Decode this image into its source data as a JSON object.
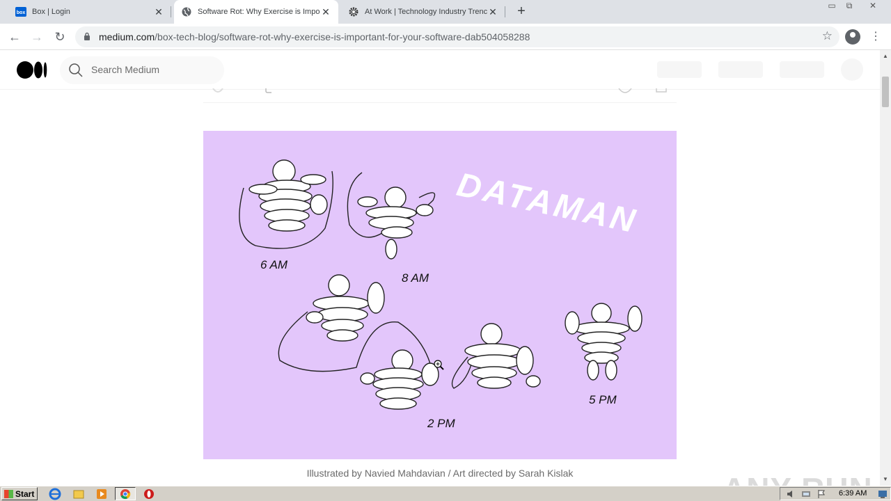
{
  "browser": {
    "tabs": [
      {
        "title": "Box | Login",
        "favicon": "box-favicon",
        "active": false
      },
      {
        "title": "Software Rot: Why Exercise is Impor",
        "favicon": "globe-icon",
        "active": true
      },
      {
        "title": "At Work | Technology Industry Trenc",
        "favicon": "gear-favicon",
        "active": false
      }
    ],
    "new_tab_label": "+",
    "url_host": "medium.com",
    "url_path": "/box-tech-blog/software-rot-why-exercise-is-important-for-your-software-dab504058288"
  },
  "medium": {
    "search_placeholder": "Search Medium"
  },
  "article": {
    "image_texts": {
      "title": "DATAMAN",
      "label_6am": "6 AM",
      "label_8am": "8 AM",
      "label_2pm": "2 PM",
      "label_5pm": "5 PM"
    },
    "caption": "Illustrated by Navied Mahdavian / Art directed by Sarah Kislak"
  },
  "watermark": "ANY RUN",
  "taskbar": {
    "start_label": "Start",
    "clock": "6:39 AM"
  },
  "colors": {
    "figure_bg": "#e3c6fb",
    "chrome_bg": "#dee1e6"
  }
}
